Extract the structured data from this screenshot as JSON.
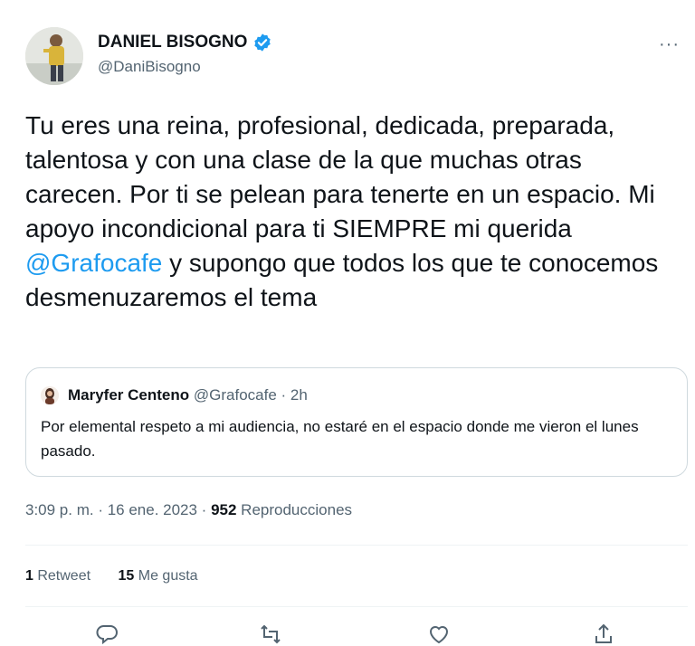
{
  "author": {
    "name": "DANIEL BISOGNO",
    "handle": "@DaniBisogno"
  },
  "menu": {
    "more_label": "···"
  },
  "tweet": {
    "text_before": "Tu eres una reina, profesional, dedicada, preparada, talentosa y con una clase de la que muchas otras carecen. Por ti se pelean para tenerte en un espacio. Mi apoyo incondicional para ti SIEMPRE mi querida ",
    "mention": "@Grafocafe",
    "text_after": " y supongo que todos los que te conocemos desmenuzaremos el tema"
  },
  "quote": {
    "name": "Maryfer Centeno",
    "handle_time": "@Grafocafe · 2h",
    "text": "Por elemental respeto a mi audiencia, no estaré en el espacio donde me vieron el lunes pasado."
  },
  "meta": {
    "time_date": "3:09 p. m. · 16 ene. 2023 · ",
    "views_count": "952",
    "views_label": " Reproducciones"
  },
  "stats": {
    "retweets_count": "1",
    "retweets_label": " Retweet",
    "likes_count": "15",
    "likes_label": " Me gusta"
  },
  "icons": [
    "reply-icon",
    "retweet-icon",
    "like-icon",
    "share-icon"
  ],
  "colors": {
    "accent": "#1d9bf0",
    "secondary_text": "#536471",
    "border": "#cfd9de"
  }
}
